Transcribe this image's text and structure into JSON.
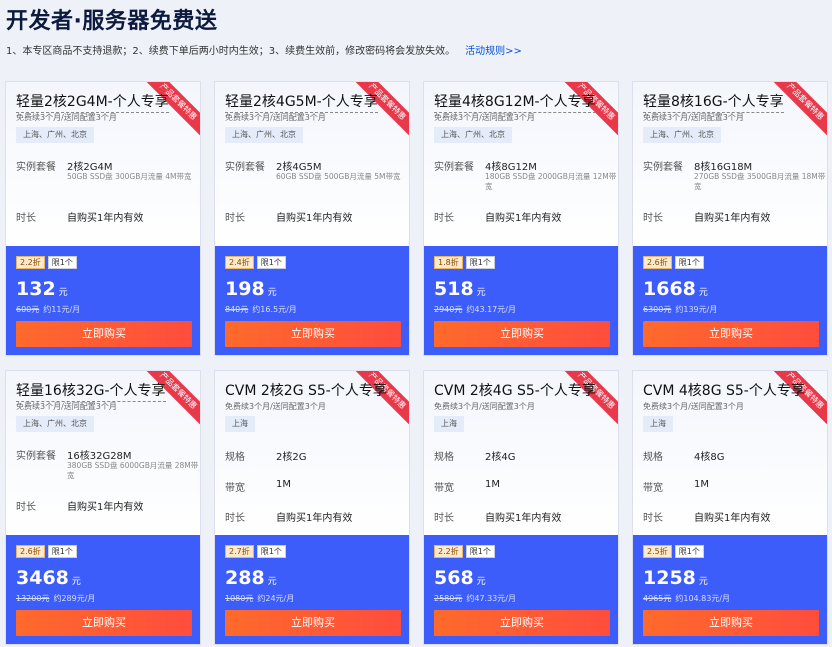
{
  "page": {
    "title": "开发者·服务器免费送",
    "rules": "1、本专区商品不支持退款；2、续费下单后两小时内生效；3、续费生效前，修改密码将会发放失效。",
    "rules_link": "活动规则>>"
  },
  "common": {
    "ribbon": "产品套餐特惠",
    "renew_note": "免费续3个月/送同配置3个月",
    "regions": "上海、广州、北京",
    "region_shanghai": "上海",
    "limit": "限1个",
    "currency": "元",
    "buy": "立即购买",
    "label_package": "实例套餐",
    "label_spec": "规格",
    "label_bandwidth": "带宽",
    "label_duration": "时长",
    "duration": "自购买1年内有效",
    "colors": {
      "accent_blue": "#3d5dfa",
      "button_orange": "#ff6a2b",
      "ribbon_red": "#e8384a"
    }
  },
  "cards": [
    {
      "title": "轻量2核2G4M-个人专享",
      "package": "2核2G4M",
      "detail": "50GB SSD盘 300GB月流量 4M带宽",
      "discount": "2.2折",
      "price": "132",
      "original": "600元",
      "monthly": "约11元/月"
    },
    {
      "title": "轻量2核4G5M-个人专享",
      "package": "2核4G5M",
      "detail": "60GB SSD盘 500GB月流量 5M带宽",
      "discount": "2.4折",
      "price": "198",
      "original": "840元",
      "monthly": "约16.5元/月"
    },
    {
      "title": "轻量4核8G12M-个人专享",
      "package": "4核8G12M",
      "detail": "180GB SSD盘 2000GB月流量 12M带宽",
      "discount": "1.8折",
      "price": "518",
      "original": "2940元",
      "monthly": "约43.17元/月"
    },
    {
      "title": "轻量8核16G-个人专享",
      "package": "8核16G18M",
      "detail": "270GB SSD盘 3500GB月流量 18M带宽",
      "discount": "2.6折",
      "price": "1668",
      "original": "6300元",
      "monthly": "约139元/月"
    },
    {
      "title": "轻量16核32G-个人专享",
      "package": "16核32G28M",
      "detail": "380GB SSD盘 6000GB月流量 28M带宽",
      "discount": "2.6折",
      "price": "3468",
      "original": "13200元",
      "monthly": "约289元/月"
    },
    {
      "title": "CVM 2核2G S5-个人专享",
      "spec": "2核2G",
      "bandwidth": "1M",
      "discount": "2.7折",
      "price": "288",
      "original": "1080元",
      "monthly": "约24元/月"
    },
    {
      "title": "CVM 2核4G S5-个人专享",
      "spec": "2核4G",
      "bandwidth": "1M",
      "discount": "2.2折",
      "price": "568",
      "original": "2580元",
      "monthly": "约47.33元/月"
    },
    {
      "title": "CVM 4核8G S5-个人专享",
      "spec": "4核8G",
      "bandwidth": "1M",
      "discount": "2.5折",
      "price": "1258",
      "original": "4965元",
      "monthly": "约104.83元/月"
    }
  ]
}
